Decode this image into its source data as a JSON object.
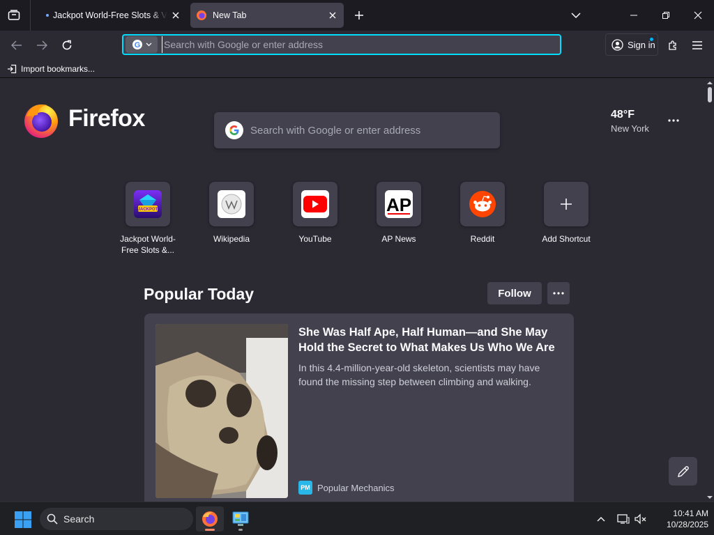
{
  "browser": {
    "tabs": [
      {
        "title": "Jackpot World-Free Slots & Vegas",
        "active": false
      },
      {
        "title": "New Tab",
        "active": true
      }
    ],
    "urlbar": {
      "placeholder": "Search with Google or enter address",
      "value": ""
    },
    "signin_label": "Sign in",
    "bookmarks": {
      "import_label": "Import bookmarks..."
    }
  },
  "newtab": {
    "wordmark": "Firefox",
    "search_placeholder": "Search with Google or enter address",
    "weather": {
      "temp": "48°F",
      "city": "New York"
    },
    "shortcuts": [
      {
        "label": "Jackpot World-Free Slots &...",
        "icon": "jackpot-world-icon"
      },
      {
        "label": "Wikipedia",
        "icon": "wikipedia-icon"
      },
      {
        "label": "YouTube",
        "icon": "youtube-icon"
      },
      {
        "label": "AP News",
        "icon": "ap-news-icon"
      },
      {
        "label": "Reddit",
        "icon": "reddit-icon"
      },
      {
        "label": "Add Shortcut",
        "icon": "plus-icon"
      }
    ],
    "popular": {
      "title": "Popular Today",
      "follow_label": "Follow",
      "story": {
        "title": "She Was Half Ape, Half Human—and She May Hold the Secret to What Makes Us Who We Are",
        "excerpt": "In this 4.4-million-year-old skeleton, scientists may have found the missing step between climbing and walking.",
        "source": "Popular Mechanics",
        "source_badge": "PM"
      }
    }
  },
  "taskbar": {
    "search_label": "Search",
    "time": "10:41 AM",
    "date": "10/28/2025"
  },
  "colors": {
    "accent": "#00ddff",
    "content_bg": "#2b2a33",
    "tabstrip_bg": "#1c1b22",
    "card_bg": "#42414d"
  }
}
